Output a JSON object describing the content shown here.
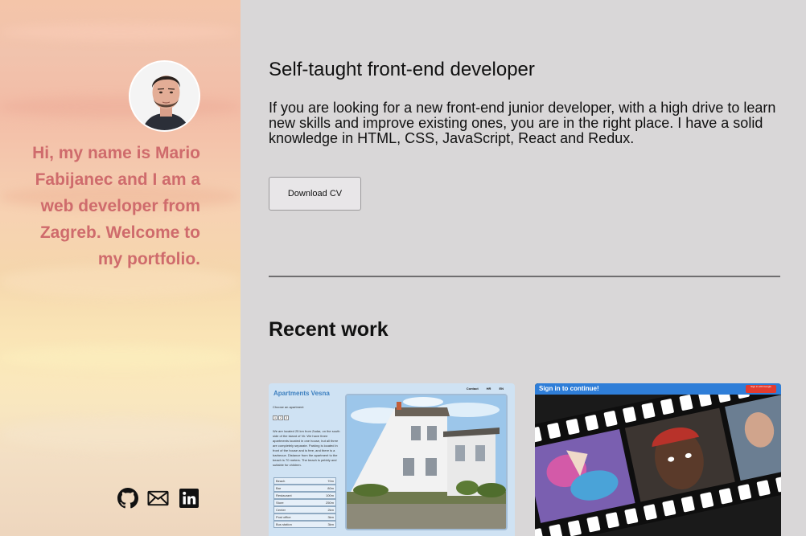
{
  "sidebar": {
    "intro_text": "Hi, my name is Mario Fabijanec and I am a web developer from Zagreb. Welcome to my portfolio.",
    "socials": [
      {
        "icon": "github-icon",
        "label": "GitHub"
      },
      {
        "icon": "mail-icon",
        "label": "Email"
      },
      {
        "icon": "linkedin-icon",
        "label": "LinkedIn"
      }
    ]
  },
  "main": {
    "headline": "Self-taught front-end developer",
    "about": "If you are looking for a new front-end junior developer, with a high drive to learn new skills and improve existing ones, you are in the right place. I have a solid knowledge in HTML, CSS, JavaScript, React and Redux.",
    "download_cv_label": "Download CV",
    "recent_work_title": "Recent work"
  },
  "projects": {
    "apartments": {
      "brand": "Apartments Vesna",
      "nav": [
        "Contact",
        "HR",
        "EN"
      ],
      "choose_label": "Choose an apartment",
      "pages": [
        "1",
        "2",
        "3"
      ],
      "description": "We are located 25 km from Zadar, on the south side of the island of Vir. We have three apartments located in one house, but all three are completely separate. Parking is located in front of the house and is free, and there is a barbecue. Distance from the apartment to the beach is 70 meters. The beach is pebbly and suitable for children.",
      "distances": [
        {
          "place": "Beach",
          "distance": "70m"
        },
        {
          "place": "Bar",
          "distance": "80m"
        },
        {
          "place": "Restaurant",
          "distance": "100m"
        },
        {
          "place": "Store",
          "distance": "250m"
        },
        {
          "place": "Center",
          "distance": "2km"
        },
        {
          "place": "Post office",
          "distance": "3km"
        },
        {
          "place": "Bus station",
          "distance": "3km"
        }
      ]
    },
    "movies": {
      "signin_text": "Sign in to continue!",
      "google_button": "Sign in with Google"
    }
  },
  "colors": {
    "intro_text": "#cf6b6c",
    "main_background": "#d9d7d8",
    "card2_bar": "#2f7ed8",
    "google_button": "#e33b2f"
  }
}
